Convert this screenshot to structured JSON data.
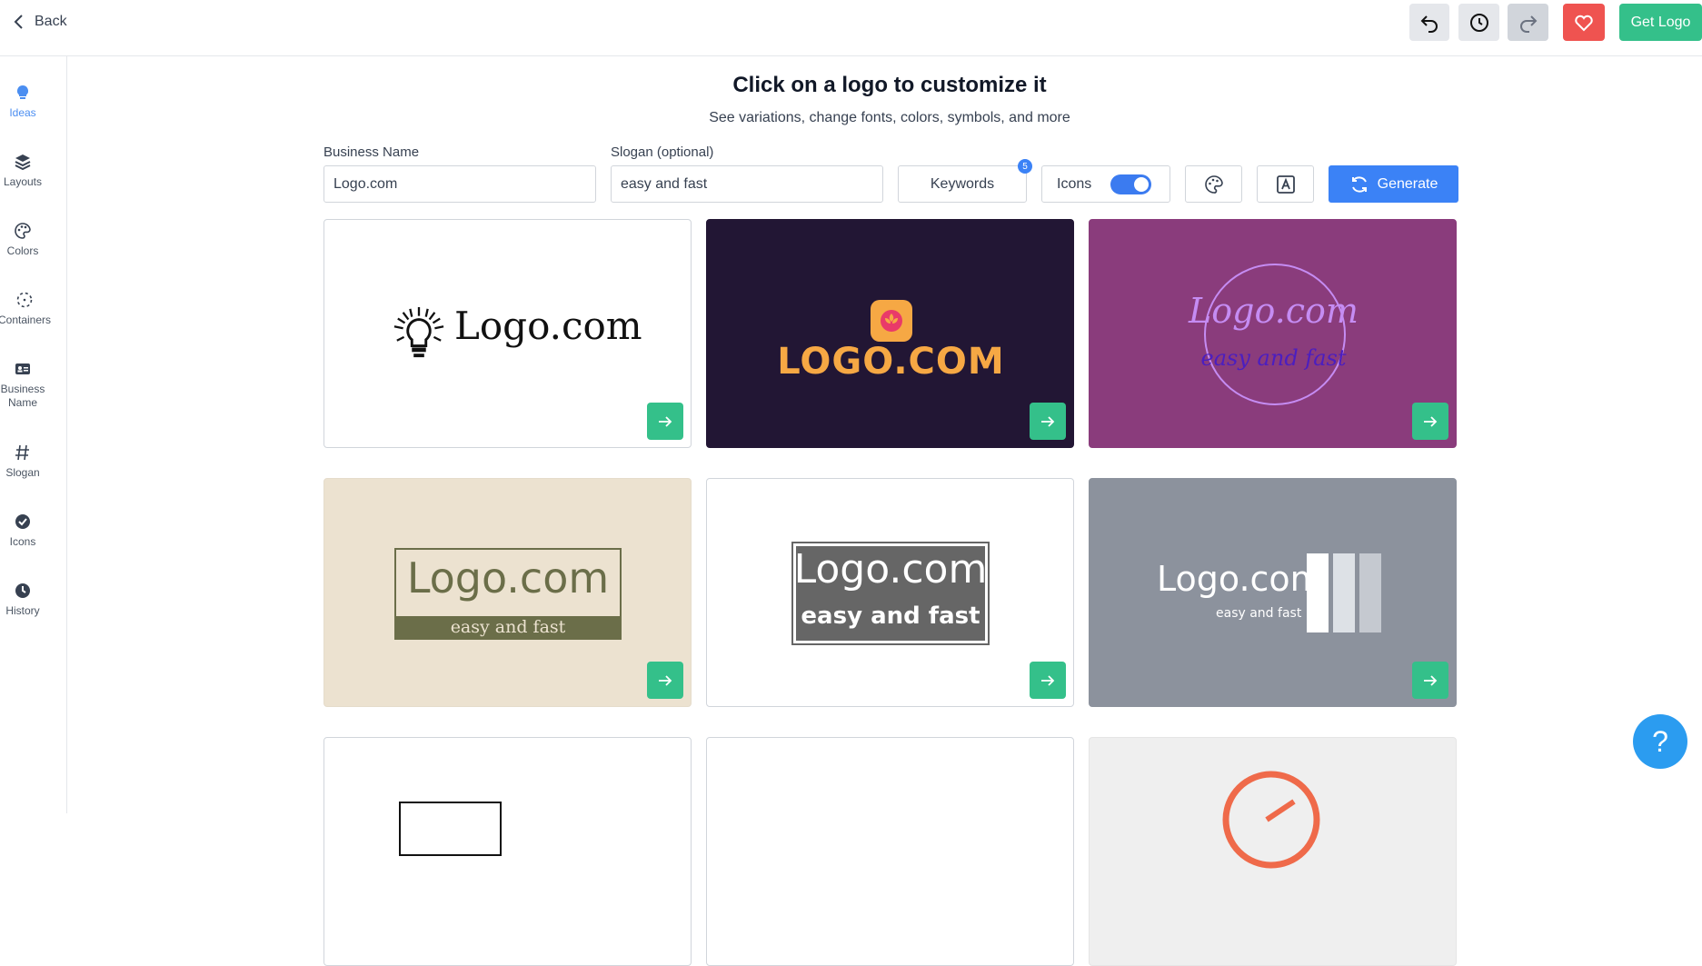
{
  "topbar": {
    "back_label": "Back",
    "get_logo_label": "Get Logo"
  },
  "sidebar": {
    "items": [
      {
        "label": "Ideas",
        "icon": "lightbulb-icon"
      },
      {
        "label": "Layouts",
        "icon": "layers-icon"
      },
      {
        "label": "Colors",
        "icon": "palette-icon"
      },
      {
        "label": "Containers",
        "icon": "container-icon"
      },
      {
        "label": "Business Name",
        "icon": "id-card-icon"
      },
      {
        "label": "Slogan",
        "icon": "hash-icon"
      },
      {
        "label": "Icons",
        "icon": "check-circle-icon"
      },
      {
        "label": "History",
        "icon": "clock-icon"
      }
    ]
  },
  "header": {
    "title": "Click on a logo to customize it",
    "subtitle": "See variations, change fonts, colors, symbols, and more"
  },
  "form": {
    "business_name_label": "Business Name",
    "business_name_value": "Logo.com",
    "slogan_label": "Slogan (optional)",
    "slogan_value": "easy and fast",
    "keywords_label": "Keywords",
    "keywords_count": "5",
    "icons_label": "Icons",
    "icons_enabled": true,
    "generate_label": "Generate"
  },
  "cards": [
    {
      "name": "Logo.com",
      "slogan": "",
      "background": "#ffffff",
      "text_color": "#111111"
    },
    {
      "name": "LOGO.COM",
      "slogan": "",
      "background": "#221634",
      "text_color": "#f6a844"
    },
    {
      "name": "Logo.com",
      "slogan": "easy and fast",
      "background": "#8a3c7c",
      "text_color": "#c58cf3",
      "slogan_color": "#4b1ec0"
    },
    {
      "name": "Logo.com",
      "slogan": "easy and fast",
      "background": "#ece2d0",
      "text_color": "#6b6e49"
    },
    {
      "name": "Logo.com",
      "slogan": "easy and fast",
      "background": "#ffffff",
      "text_color": "#666666"
    },
    {
      "name": "Logo.com",
      "slogan": "easy and fast",
      "background": "#8c929d",
      "text_color": "#ffffff"
    },
    {
      "name": "",
      "slogan": "",
      "background": "#ffffff"
    },
    {
      "name": "",
      "slogan": "",
      "background": "#ffffff"
    },
    {
      "name": "",
      "slogan": "",
      "background": "#efefef"
    }
  ],
  "colors": {
    "accent_blue": "#3b82f6",
    "action_green": "#34c08a",
    "favorite_red": "#ef5350",
    "help_blue": "#2b9cf0"
  }
}
